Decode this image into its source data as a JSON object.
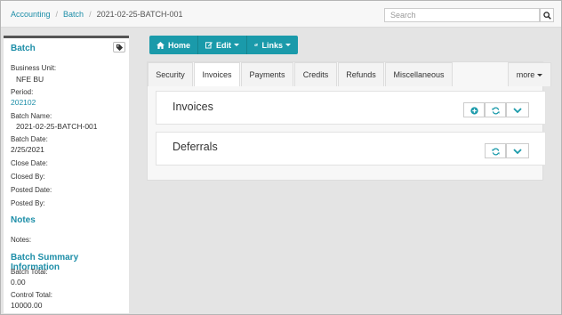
{
  "breadcrumb": {
    "items": [
      "Accounting",
      "Batch",
      "2021-02-25-BATCH-001"
    ]
  },
  "search": {
    "placeholder": "Search"
  },
  "sidebar": {
    "batch_title": "Batch",
    "business_unit_label": "Business Unit:",
    "business_unit_value": "NFE BU",
    "period_label": "Period:",
    "period_value": "202102",
    "batch_name_label": "Batch Name:",
    "batch_name_value": "2021-02-25-BATCH-001",
    "batch_date_label": "Batch Date:",
    "batch_date_value": "2/25/2021",
    "close_date_label": "Close Date:",
    "closed_by_label": "Closed By:",
    "posted_date_label": "Posted Date:",
    "posted_by_label": "Posted By:",
    "notes_title": "Notes",
    "notes_label": "Notes:",
    "summary_title": "Batch Summary Information",
    "batch_total_label": "Batch Total:",
    "batch_total_value": "0.00",
    "control_total_label": "Control Total:",
    "control_total_value": "10000.00"
  },
  "toolbar": {
    "home": "Home",
    "edit": "Edit",
    "links": "Links"
  },
  "tabs": [
    "Security",
    "Invoices",
    "Payments",
    "Credits",
    "Refunds",
    "Miscellaneous"
  ],
  "more": "more",
  "sections": {
    "invoices": "Invoices",
    "deferrals": "Deferrals"
  },
  "colors": {
    "accent": "#1a9aaa",
    "link": "#1d8ea8"
  },
  "icons": [
    "home-icon",
    "edit-icon",
    "link-icon",
    "search-icon",
    "tag-icon",
    "plus-icon",
    "refresh-icon",
    "chevron-down-icon"
  ]
}
